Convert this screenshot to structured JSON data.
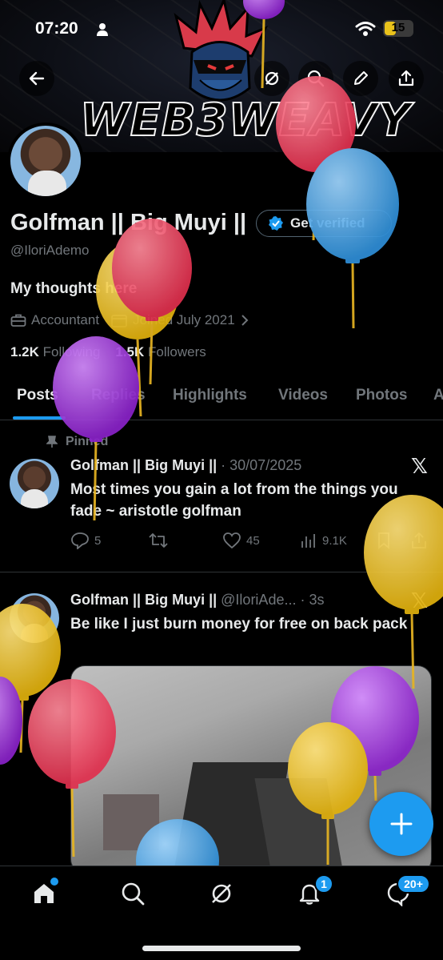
{
  "status_bar": {
    "time": "07:20",
    "battery": "15"
  },
  "banner": {
    "logo_text": "WEB3WEAVY"
  },
  "profile": {
    "name": "Golfman || Big Muyi ||",
    "get_verified": "Get verified",
    "handle": "@IloriAdemo",
    "bio": "My thoughts here",
    "occupation": "Accountant",
    "joined": "Joined July 2021",
    "following_count": "1.2K",
    "following_label": "Following",
    "followers_count": "1.5K",
    "followers_label": "Followers"
  },
  "tabs": [
    "Posts",
    "Replies",
    "Highlights",
    "Videos",
    "Photos",
    "A"
  ],
  "posts": [
    {
      "pinned_label": "Pinned",
      "author": "Golfman || Big Muyi ||",
      "meta": " · 30/07/2025",
      "text": "Most times you gain a lot from the things you fade ~ aristotle golfman",
      "replies": "5",
      "likes": "45",
      "views": "9.1K"
    },
    {
      "author": "Golfman || Big Muyi ||",
      "meta": " @IloriAde... · 3s",
      "text": "Be like I just burn money for free on back pack"
    }
  ],
  "bottom_nav": {
    "notifications_badge": "1",
    "messages_badge": "20+"
  },
  "colors": {
    "accent": "#1d9bf0",
    "background": "#000000",
    "muted": "#71767b"
  }
}
